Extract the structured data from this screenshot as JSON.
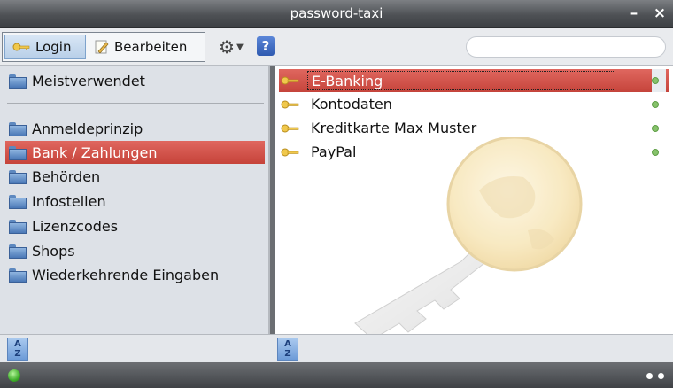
{
  "window": {
    "title": "password-taxi",
    "minimize_icon": "minimize-icon",
    "close_icon": "close-icon"
  },
  "toolbar": {
    "login_label": "Login",
    "edit_label": "Bearbeiten",
    "settings_icon": "gear-icon",
    "help_label": "?",
    "search_placeholder": ""
  },
  "sidebar": {
    "top_item": "Meistverwendet",
    "items": [
      {
        "label": "Anmeldeprinzip",
        "selected": false
      },
      {
        "label": "Bank / Zahlungen",
        "selected": true
      },
      {
        "label": "Behörden",
        "selected": false
      },
      {
        "label": "Infostellen",
        "selected": false
      },
      {
        "label": "Lizenzcodes",
        "selected": false
      },
      {
        "label": "Shops",
        "selected": false
      },
      {
        "label": "Wiederkehrende Eingaben",
        "selected": false
      }
    ]
  },
  "entries": [
    {
      "label": "E-Banking",
      "selected": true
    },
    {
      "label": "Kontodaten",
      "selected": false
    },
    {
      "label": "Kreditkarte Max Muster",
      "selected": false
    },
    {
      "label": "PayPal",
      "selected": false
    }
  ],
  "bottom": {
    "sort_label_top": "A",
    "sort_label_bottom": "Z"
  },
  "colors": {
    "selection": "#d4544b",
    "status_ok": "#86c26b",
    "accent": "#6d9bd8"
  }
}
